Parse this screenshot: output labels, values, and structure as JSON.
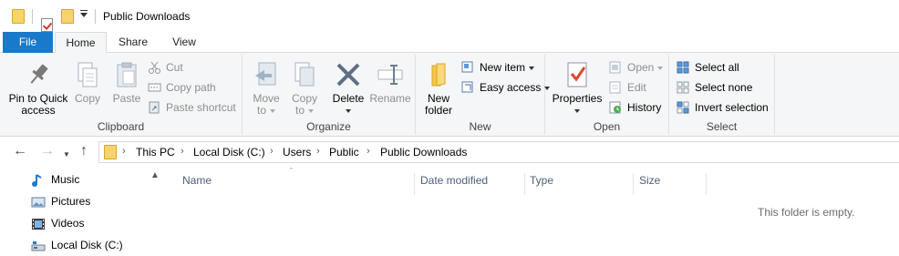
{
  "window": {
    "title": "Public Downloads"
  },
  "tabs": [
    {
      "label": "File"
    },
    {
      "label": "Home"
    },
    {
      "label": "Share"
    },
    {
      "label": "View"
    }
  ],
  "ribbon": {
    "clipboard": {
      "label": "Clipboard",
      "pin_line1": "Pin to Quick",
      "pin_line2": "access",
      "copy": "Copy",
      "paste": "Paste",
      "cut": "Cut",
      "copy_path": "Copy path",
      "paste_shortcut": "Paste shortcut"
    },
    "organize": {
      "label": "Organize",
      "move_line1": "Move",
      "move_line2": "to",
      "copy_line1": "Copy",
      "copy_line2": "to",
      "delete": "Delete",
      "rename": "Rename"
    },
    "new": {
      "label": "New",
      "folder_line1": "New",
      "folder_line2": "folder",
      "new_item": "New item",
      "easy_access": "Easy access"
    },
    "open": {
      "label": "Open",
      "properties": "Properties",
      "open": "Open",
      "edit": "Edit",
      "history": "History"
    },
    "select": {
      "label": "Select",
      "select_all": "Select all",
      "select_none": "Select none",
      "invert": "Invert selection"
    }
  },
  "address": {
    "crumbs": [
      "This PC",
      "Local Disk (C:)",
      "Users",
      "Public",
      "Public Downloads"
    ]
  },
  "nav_pane": {
    "items": [
      {
        "label": "Music",
        "icon": "music-icon"
      },
      {
        "label": "Pictures",
        "icon": "pictures-icon"
      },
      {
        "label": "Videos",
        "icon": "videos-icon"
      },
      {
        "label": "Local Disk (C:)",
        "icon": "drive-icon"
      }
    ]
  },
  "columns": [
    {
      "label": "Name"
    },
    {
      "label": "Date modified"
    },
    {
      "label": "Type"
    },
    {
      "label": "Size"
    }
  ],
  "empty_message": "This folder is empty.",
  "colors": {
    "accent": "#1979ca",
    "folder": "#f7d46b",
    "ribbon_bg": "#f5f6f7",
    "disabled_text": "#8e8e8e"
  }
}
